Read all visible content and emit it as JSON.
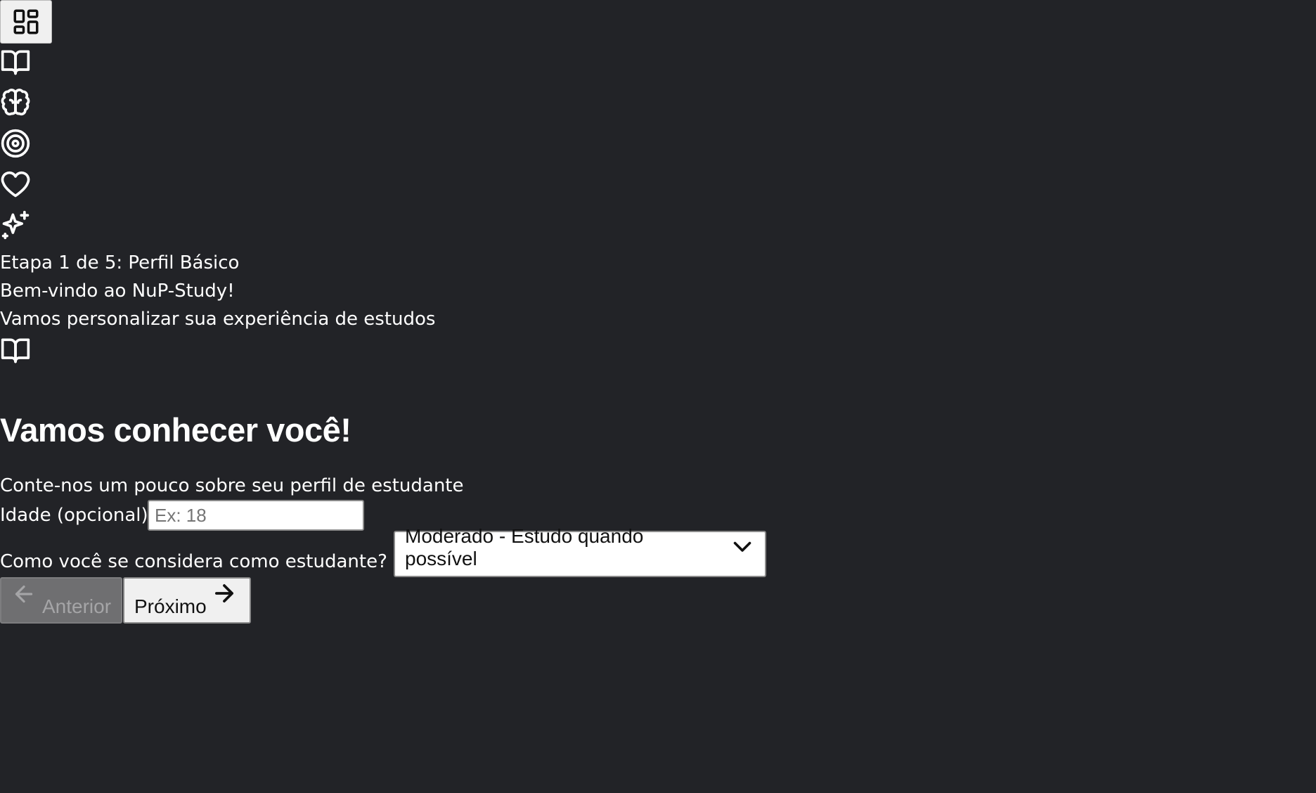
{
  "nav": {
    "icons": [
      "dashboard-icon",
      "book-icon",
      "brain-icon",
      "target-icon",
      "heart-icon",
      "sparkles-icon"
    ]
  },
  "onboarding": {
    "step": "Etapa 1 de 5: Perfil Básico",
    "welcome": "Bem-vindo ao NuP-Study!",
    "subtitle": "Vamos personalizar sua experiência de estudos",
    "heading": "Vamos conhecer você!",
    "description": "Conte-nos um pouco sobre seu perfil de estudante",
    "age_label": "Idade (opcional)",
    "age_placeholder": "Ex: 18",
    "age_value": "",
    "student_type_label": "Como você se considera como estudante?",
    "student_type_value": "Moderado - Estudo quando possível",
    "prev_label": "Anterior",
    "next_label": "Próximo"
  },
  "colors": {
    "background": "#222327",
    "text": "#ffffff",
    "button_disabled": "#6f6f71"
  }
}
